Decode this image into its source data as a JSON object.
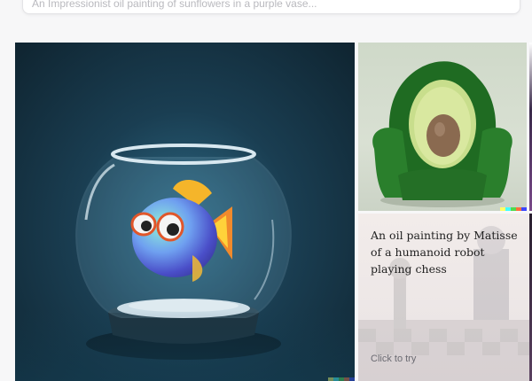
{
  "prompt": {
    "placeholder": "An Impressionist oil painting of sunflowers in a purple vase..."
  },
  "gallery": {
    "tiles": [
      {
        "alt": "3D render of a cartoon fish in a glass fishbowl"
      },
      {
        "alt": "Green velvet armchair shaped like an avocado"
      },
      {
        "caption": "An oil painting by Matisse of a humanoid robot playing chess",
        "cta": "Click to try"
      }
    ]
  },
  "colors": {
    "page_bg": "#f7f7f8",
    "watermark": [
      "#ffff66",
      "#42ffff",
      "#51da4c",
      "#ff6e3c",
      "#3c46ff"
    ]
  }
}
